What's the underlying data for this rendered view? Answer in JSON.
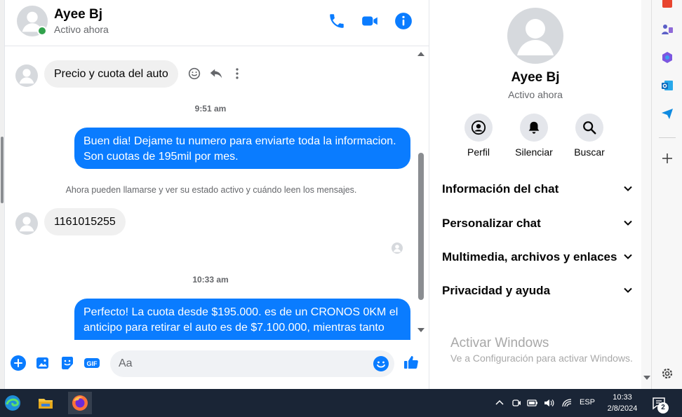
{
  "chat": {
    "contact_name": "Ayee Bj",
    "contact_status": "Activo ahora",
    "messages": [
      {
        "text": "Precio y cuota del auto"
      },
      {
        "text": "9:51 am"
      },
      {
        "text": "Buen dia! Dejame tu numero para enviarte toda la informacion. Son cuotas de 195mil por mes."
      },
      {
        "text": "Ahora pueden llamarse y ver su estado activo y cuándo leen los mensajes."
      },
      {
        "text": "1161015255"
      },
      {
        "text": "10:33 am"
      },
      {
        "text": "Perfecto! La cuota desde $195.000. es de un CRONOS 0KM el anticipo para retirar el auto es de $7.100.000, mientras tanto"
      }
    ],
    "composer_placeholder": "Aa"
  },
  "info": {
    "name": "Ayee Bj",
    "status": "Activo ahora",
    "actions": [
      {
        "label": "Perfil",
        "icon": "profile-icon"
      },
      {
        "label": "Silenciar",
        "icon": "bell-icon"
      },
      {
        "label": "Buscar",
        "icon": "search-icon"
      }
    ],
    "sections": [
      {
        "label": "Información del chat"
      },
      {
        "label": "Personalizar chat"
      },
      {
        "label": "Multimedia, archivos y enlaces"
      },
      {
        "label": "Privacidad y ayuda"
      }
    ],
    "watermark_title": "Activar Windows",
    "watermark_sub": "Ve a Configuración para activar Windows."
  },
  "taskbar": {
    "language": "ESP",
    "time": "10:33",
    "date": "2/8/2024",
    "notification_count": "2"
  },
  "colors": {
    "accent": "#0a7cff",
    "incoming_bubble": "#f0f0f0",
    "online": "#31a24c",
    "taskbar": "#1a2536"
  }
}
